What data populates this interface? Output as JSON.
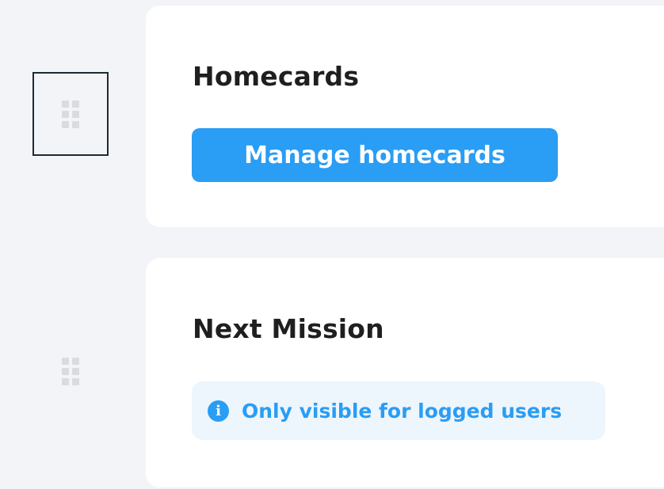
{
  "sections": [
    {
      "title": "Homecards",
      "button_label": "Manage homecards"
    },
    {
      "title": "Next Mission",
      "info_label": "Only visible for logged users",
      "info_icon": "info-circle-icon"
    }
  ],
  "colors": {
    "page_background": "#f2f4f8",
    "card_background": "#ffffff",
    "accent": "#2a9df4",
    "info_background": "#edf5fd",
    "title_text": "#1f1f1f",
    "handle_dots": "#d9dbdf"
  },
  "icons": {
    "drag_handle": "drag-handle-icon"
  }
}
